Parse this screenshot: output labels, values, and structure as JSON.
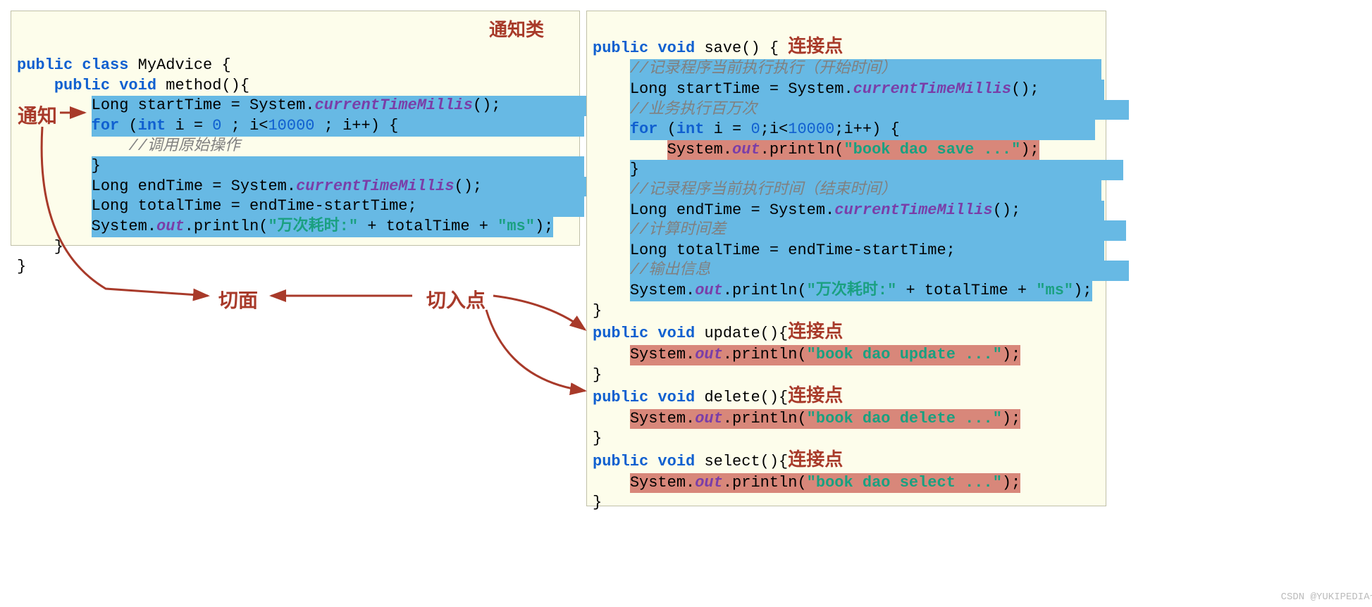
{
  "labels": {
    "tongzhilei": "通知类",
    "tongzhi": "通知",
    "qiemian": "切面",
    "qierudian": "切入点",
    "lianjiedian": "连接点"
  },
  "left": {
    "l1a": "public",
    "l1b": "class",
    "l1c": "MyAdvice",
    "l2a": "public",
    "l2b": "void",
    "l2c": "method",
    "l3a": "Long startTime = System.",
    "l3b": "currentTimeMillis",
    "l3c": "();",
    "l4a": "for",
    "l4b": "(",
    "l4c": "int",
    "l4d": " i = ",
    "l4e": "0",
    "l4f": " ; i<",
    "l4g": "10000",
    "l4h": " ; i++) {",
    "l5": "//调用原始操作",
    "l6": "}",
    "l7a": "Long endTime = System.",
    "l7b": "currentTimeMillis",
    "l7c": "();",
    "l8": "Long totalTime = endTime-startTime;",
    "l9a": "System.",
    "l9b": "out",
    "l9c": ".println(",
    "l9d": "\"万次耗时:\"",
    "l9e": " + totalTime + ",
    "l9f": "\"ms\"",
    "l9g": ");"
  },
  "right": {
    "r1a": "public",
    "r1b": "void",
    "r1c": "save",
    "r2": "//记录程序当前执行执行（开始时间）",
    "r3a": "Long startTime = System.",
    "r3b": "currentTimeMillis",
    "r3c": "();",
    "r4": "//业务执行百万次",
    "r5a": "for",
    "r5b": "(",
    "r5c": "int",
    "r5d": " i = ",
    "r5e": "0",
    "r5f": ";i<",
    "r5g": "10000",
    "r5h": ";i++) {",
    "r6a": "System.",
    "r6b": "out",
    "r6c": ".println(",
    "r6d": "\"book dao save ...\"",
    "r6e": ");",
    "r7": "}",
    "r8": "//记录程序当前执行时间（结束时间）",
    "r9a": "Long endTime = System.",
    "r9b": "currentTimeMillis",
    "r9c": "();",
    "r10": "//计算时间差",
    "r11": "Long totalTime = endTime-startTime;",
    "r12": "//输出信息",
    "r13a": "System.",
    "r13b": "out",
    "r13c": ".println(",
    "r13d": "\"万次耗时:\"",
    "r13e": " + totalTime + ",
    "r13f": "\"ms\"",
    "r13g": ");",
    "r14": "}",
    "up1a": "public",
    "up1b": "void",
    "up1c": "update",
    "up2a": "System.",
    "up2b": "out",
    "up2c": ".println(",
    "up2d": "\"book dao update ...\"",
    "up2e": ");",
    "up3": "}",
    "de1a": "public",
    "de1b": "void",
    "de1c": "delete",
    "de2a": "System.",
    "de2b": "out",
    "de2c": ".println(",
    "de2d": "\"book dao delete ...\"",
    "de2e": ");",
    "de3": "}",
    "se1a": "public",
    "se1b": "void",
    "se1c": "select",
    "se2a": "System.",
    "se2b": "out",
    "se2c": ".println(",
    "se2d": "\"book dao select ...\"",
    "se2e": ");",
    "se3": "}"
  },
  "watermark": "CSDN @YUKIPEDIA~"
}
